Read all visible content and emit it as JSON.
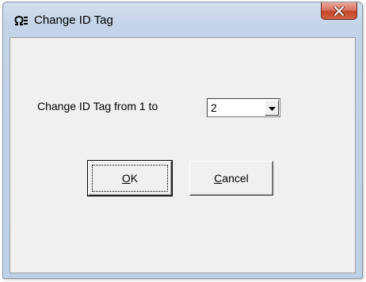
{
  "window": {
    "title": "Change ID Tag",
    "app_icon": "omega-e-logo-icon",
    "close_icon": "close-icon"
  },
  "dialog": {
    "prompt": "Change ID Tag from 1 to",
    "combo": {
      "selected": "2",
      "arrow_icon": "dropdown-arrow-icon"
    },
    "buttons": {
      "ok": {
        "mnemonic": "O",
        "rest": "K"
      },
      "cancel": {
        "mnemonic": "C",
        "rest": "ancel"
      }
    }
  }
}
